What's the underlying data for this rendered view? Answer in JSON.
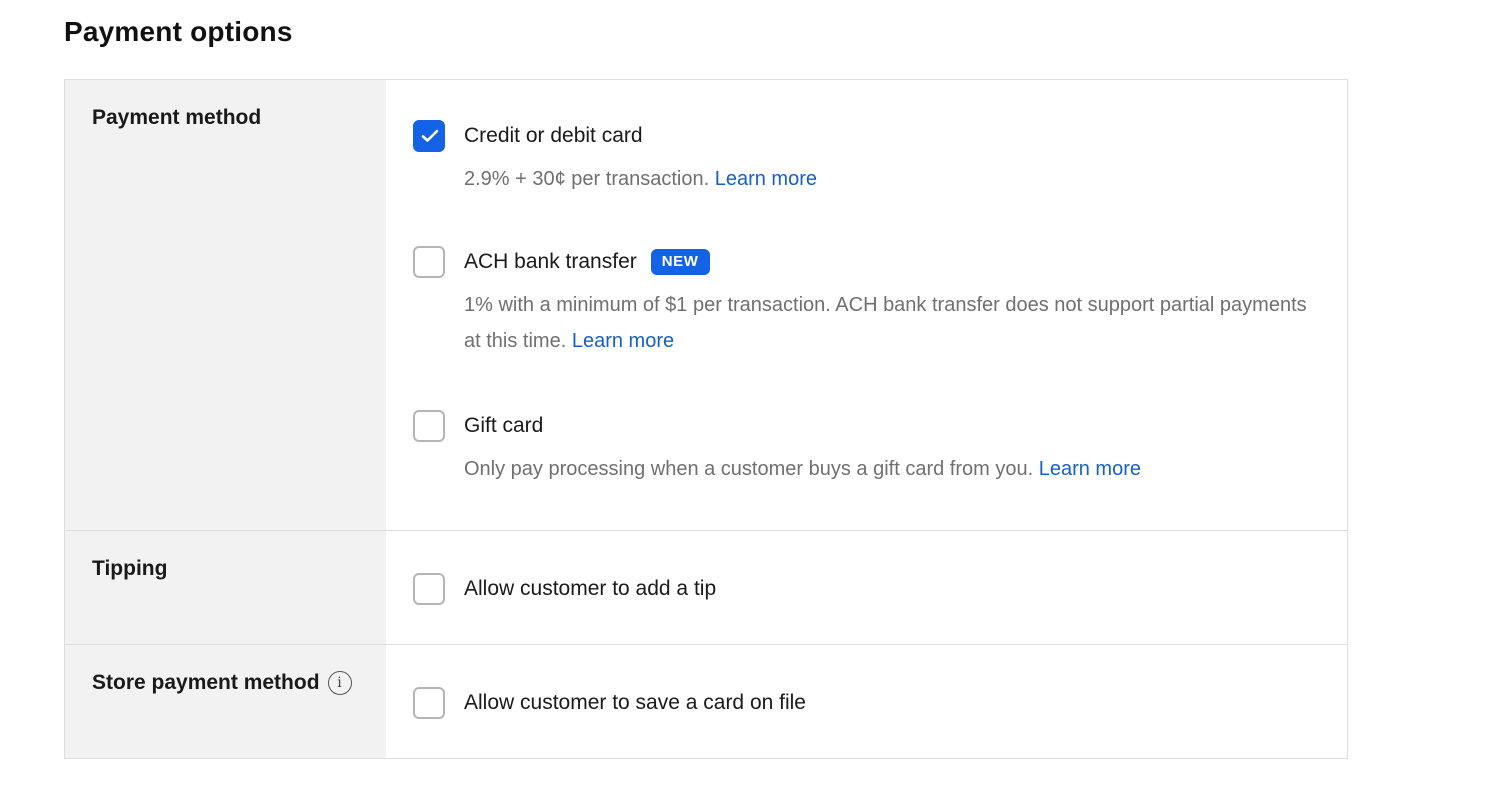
{
  "page": {
    "title": "Payment options"
  },
  "accent_color": "#1463e6",
  "link_color": "#1660c9",
  "sections": {
    "payment_method": {
      "label": "Payment method",
      "options": [
        {
          "title": "Credit or debit card",
          "checked": true,
          "description": "2.9% + 30¢ per transaction.",
          "link": "Learn more"
        },
        {
          "title": "ACH bank transfer",
          "badge": "NEW",
          "checked": false,
          "description": "1% with a minimum of $1 per transaction. ACH bank transfer does not support partial payments at this time.",
          "link": "Learn more"
        },
        {
          "title": "Gift card",
          "checked": false,
          "description": "Only pay processing when a customer buys a gift card from you.",
          "link": "Learn more"
        }
      ]
    },
    "tipping": {
      "label": "Tipping",
      "option": {
        "title": "Allow customer to add a tip",
        "checked": false
      }
    },
    "store_payment": {
      "label": "Store payment method",
      "info_icon": "info-icon",
      "info_glyph": "i",
      "option": {
        "title": "Allow customer to save a card on file",
        "checked": false
      }
    }
  }
}
